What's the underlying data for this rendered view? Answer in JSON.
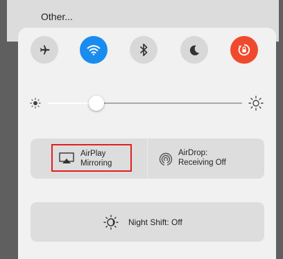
{
  "background_menu": {
    "item_label": "Other..."
  },
  "toggles": [
    {
      "name": "airplane-mode",
      "icon": "airplane-icon",
      "state": "off"
    },
    {
      "name": "wifi",
      "icon": "wifi-icon",
      "state": "on",
      "color": "#1a8cf0"
    },
    {
      "name": "bluetooth",
      "icon": "bluetooth-icon",
      "state": "off"
    },
    {
      "name": "do-not-disturb",
      "icon": "moon-icon",
      "state": "off"
    },
    {
      "name": "rotation-lock",
      "icon": "rotation-lock-icon",
      "state": "on",
      "color": "#f04a2e"
    }
  ],
  "brightness": {
    "level": 0.25
  },
  "airplay": {
    "label_line1": "AirPlay",
    "label_line2": "Mirroring",
    "highlight_color": "#e02020"
  },
  "airdrop": {
    "label_line1": "AirDrop:",
    "label_line2": "Receiving Off"
  },
  "night_shift": {
    "label": "Night Shift: Off"
  }
}
